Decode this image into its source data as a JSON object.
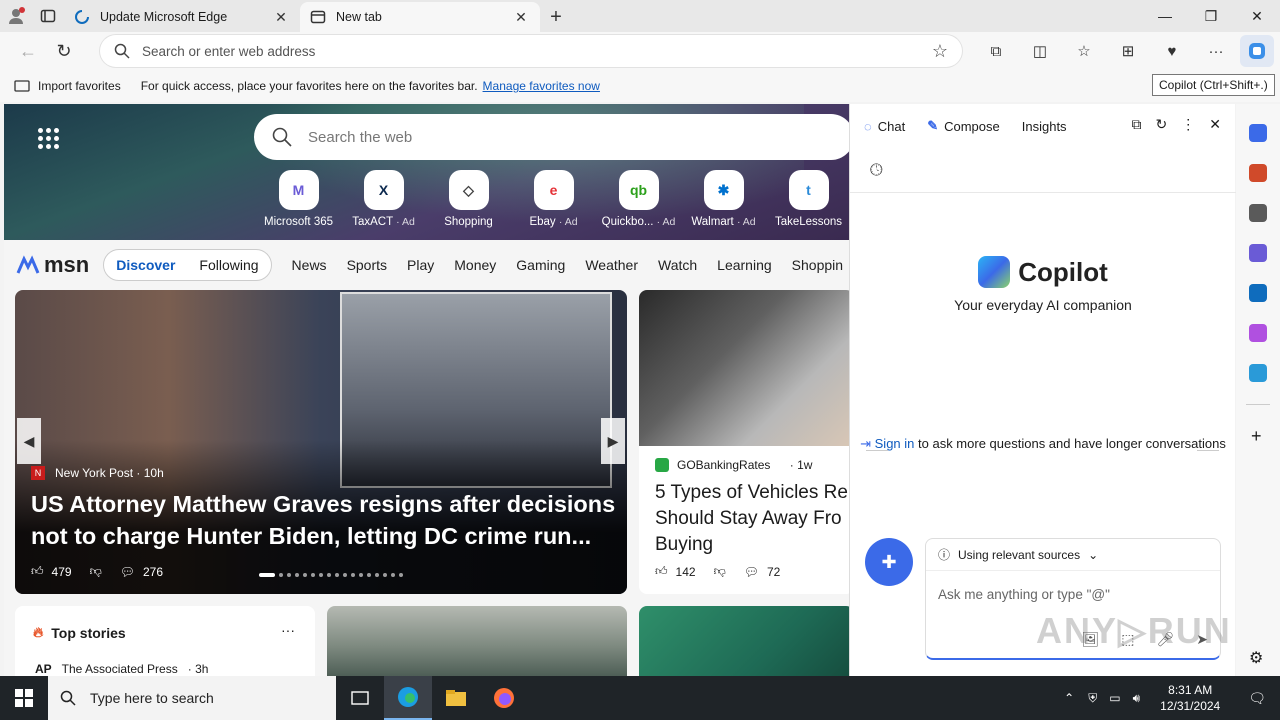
{
  "browser": {
    "tabs": [
      {
        "title": "Update Microsoft Edge"
      },
      {
        "title": "New tab"
      }
    ],
    "address_placeholder": "Search or enter web address",
    "favorites": {
      "import_label": "Import favorites",
      "hint": "For quick access, place your favorites here on the favorites bar.",
      "manage_link": "Manage favorites now"
    },
    "tooltip": "Copilot (Ctrl+Shift+.)"
  },
  "newtab": {
    "search_placeholder": "Search the web",
    "tiles": [
      {
        "label": "Microsoft 365",
        "ad": "",
        "icon": "M",
        "color": "#6a5bd6"
      },
      {
        "label": "TaxACT",
        "ad": "· Ad",
        "icon": "X",
        "color": "#0d2a4f"
      },
      {
        "label": "Shopping",
        "ad": "",
        "icon": "◇",
        "color": "#444444"
      },
      {
        "label": "Ebay",
        "ad": "· Ad",
        "icon": "e",
        "color": "#e53238"
      },
      {
        "label": "Quickbo...",
        "ad": "· Ad",
        "icon": "qb",
        "color": "#2ca01c"
      },
      {
        "label": "Walmart",
        "ad": "· Ad",
        "icon": "✱",
        "color": "#0071ce"
      },
      {
        "label": "TakeLessons",
        "ad": "",
        "icon": "t",
        "color": "#2a8ad8"
      }
    ],
    "msn_logo": "msn",
    "feed_tabs": {
      "discover": "Discover",
      "following": "Following"
    },
    "nav": [
      "News",
      "Sports",
      "Play",
      "Money",
      "Gaming",
      "Weather",
      "Watch",
      "Learning",
      "Shoppin"
    ],
    "main_story": {
      "source": "New York Post",
      "age": "· 10h",
      "headline": "US Attorney Matthew Graves resigns after decisions not to charge Hunter Biden, letting DC crime run...",
      "likes": "479",
      "comments": "276"
    },
    "side_story": {
      "source": "GOBankingRates",
      "age": "· 1w",
      "headline": "5 Types of Vehicles Re Should Stay Away Fro Buying",
      "likes": "142",
      "comments": "72"
    },
    "top_stories": {
      "title": "Top stories",
      "more": "···",
      "source_logo": "AP",
      "source": "The Associated Press",
      "age": "· 3h"
    }
  },
  "copilot": {
    "tabs": {
      "chat": "Chat",
      "compose": "Compose",
      "insights": "Insights"
    },
    "brand": "Copilot",
    "tagline": "Your everyday AI companion",
    "signin_link": "Sign in",
    "signin_rest": "to ask more questions and have longer conversations",
    "sources_label": "Using relevant sources",
    "ask_placeholder": "Ask me anything or type \"@\""
  },
  "taskbar": {
    "search_placeholder": "Type here to search",
    "time": "8:31 AM",
    "date": "12/31/2024"
  }
}
